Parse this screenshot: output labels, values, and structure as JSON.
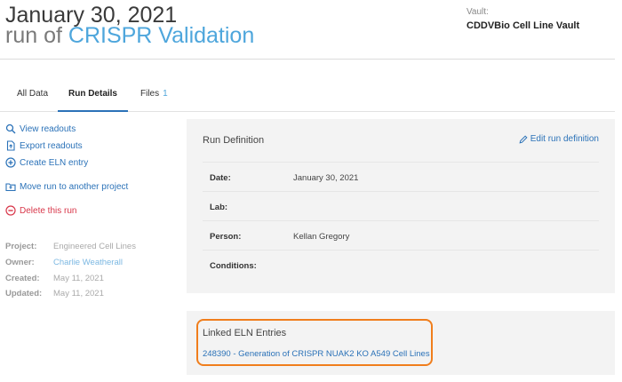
{
  "header": {
    "date": "January 30, 2021",
    "run_of": "run of",
    "project": "CRISPR Validation",
    "vault_label": "Vault:",
    "vault_name": "CDDVBio Cell Line Vault"
  },
  "tabs": [
    {
      "label": "All Data"
    },
    {
      "label": "Run Details"
    },
    {
      "label": "Files",
      "count": "1"
    }
  ],
  "actions": {
    "view_readouts": "View readouts",
    "export_readouts": "Export readouts",
    "create_eln": "Create ELN entry",
    "move_run": "Move run to another project",
    "delete_run": "Delete this run"
  },
  "meta": [
    {
      "label": "Project:",
      "value": "Engineered Cell Lines"
    },
    {
      "label": "Owner:",
      "value": "Charlie Weatherall"
    },
    {
      "label": "Created:",
      "value": "May 11, 2021"
    },
    {
      "label": "Updated:",
      "value": "May 11, 2021"
    }
  ],
  "run_definition": {
    "title": "Run Definition",
    "edit_label": "Edit run definition",
    "fields": [
      {
        "label": "Date:",
        "value": "January 30, 2021"
      },
      {
        "label": "Lab:",
        "value": ""
      },
      {
        "label": "Person:",
        "value": "Kellan Gregory"
      },
      {
        "label": "Conditions:",
        "value": ""
      }
    ]
  },
  "eln": {
    "title": "Linked ELN Entries",
    "entry": "248390 - Generation of CRISPR NUAK2 KO A549 Cell Lines"
  },
  "colors": {
    "link": "#2b72b8",
    "project_title": "#4ea6dc",
    "danger": "#d8374a",
    "highlight": "#f07e1c"
  }
}
